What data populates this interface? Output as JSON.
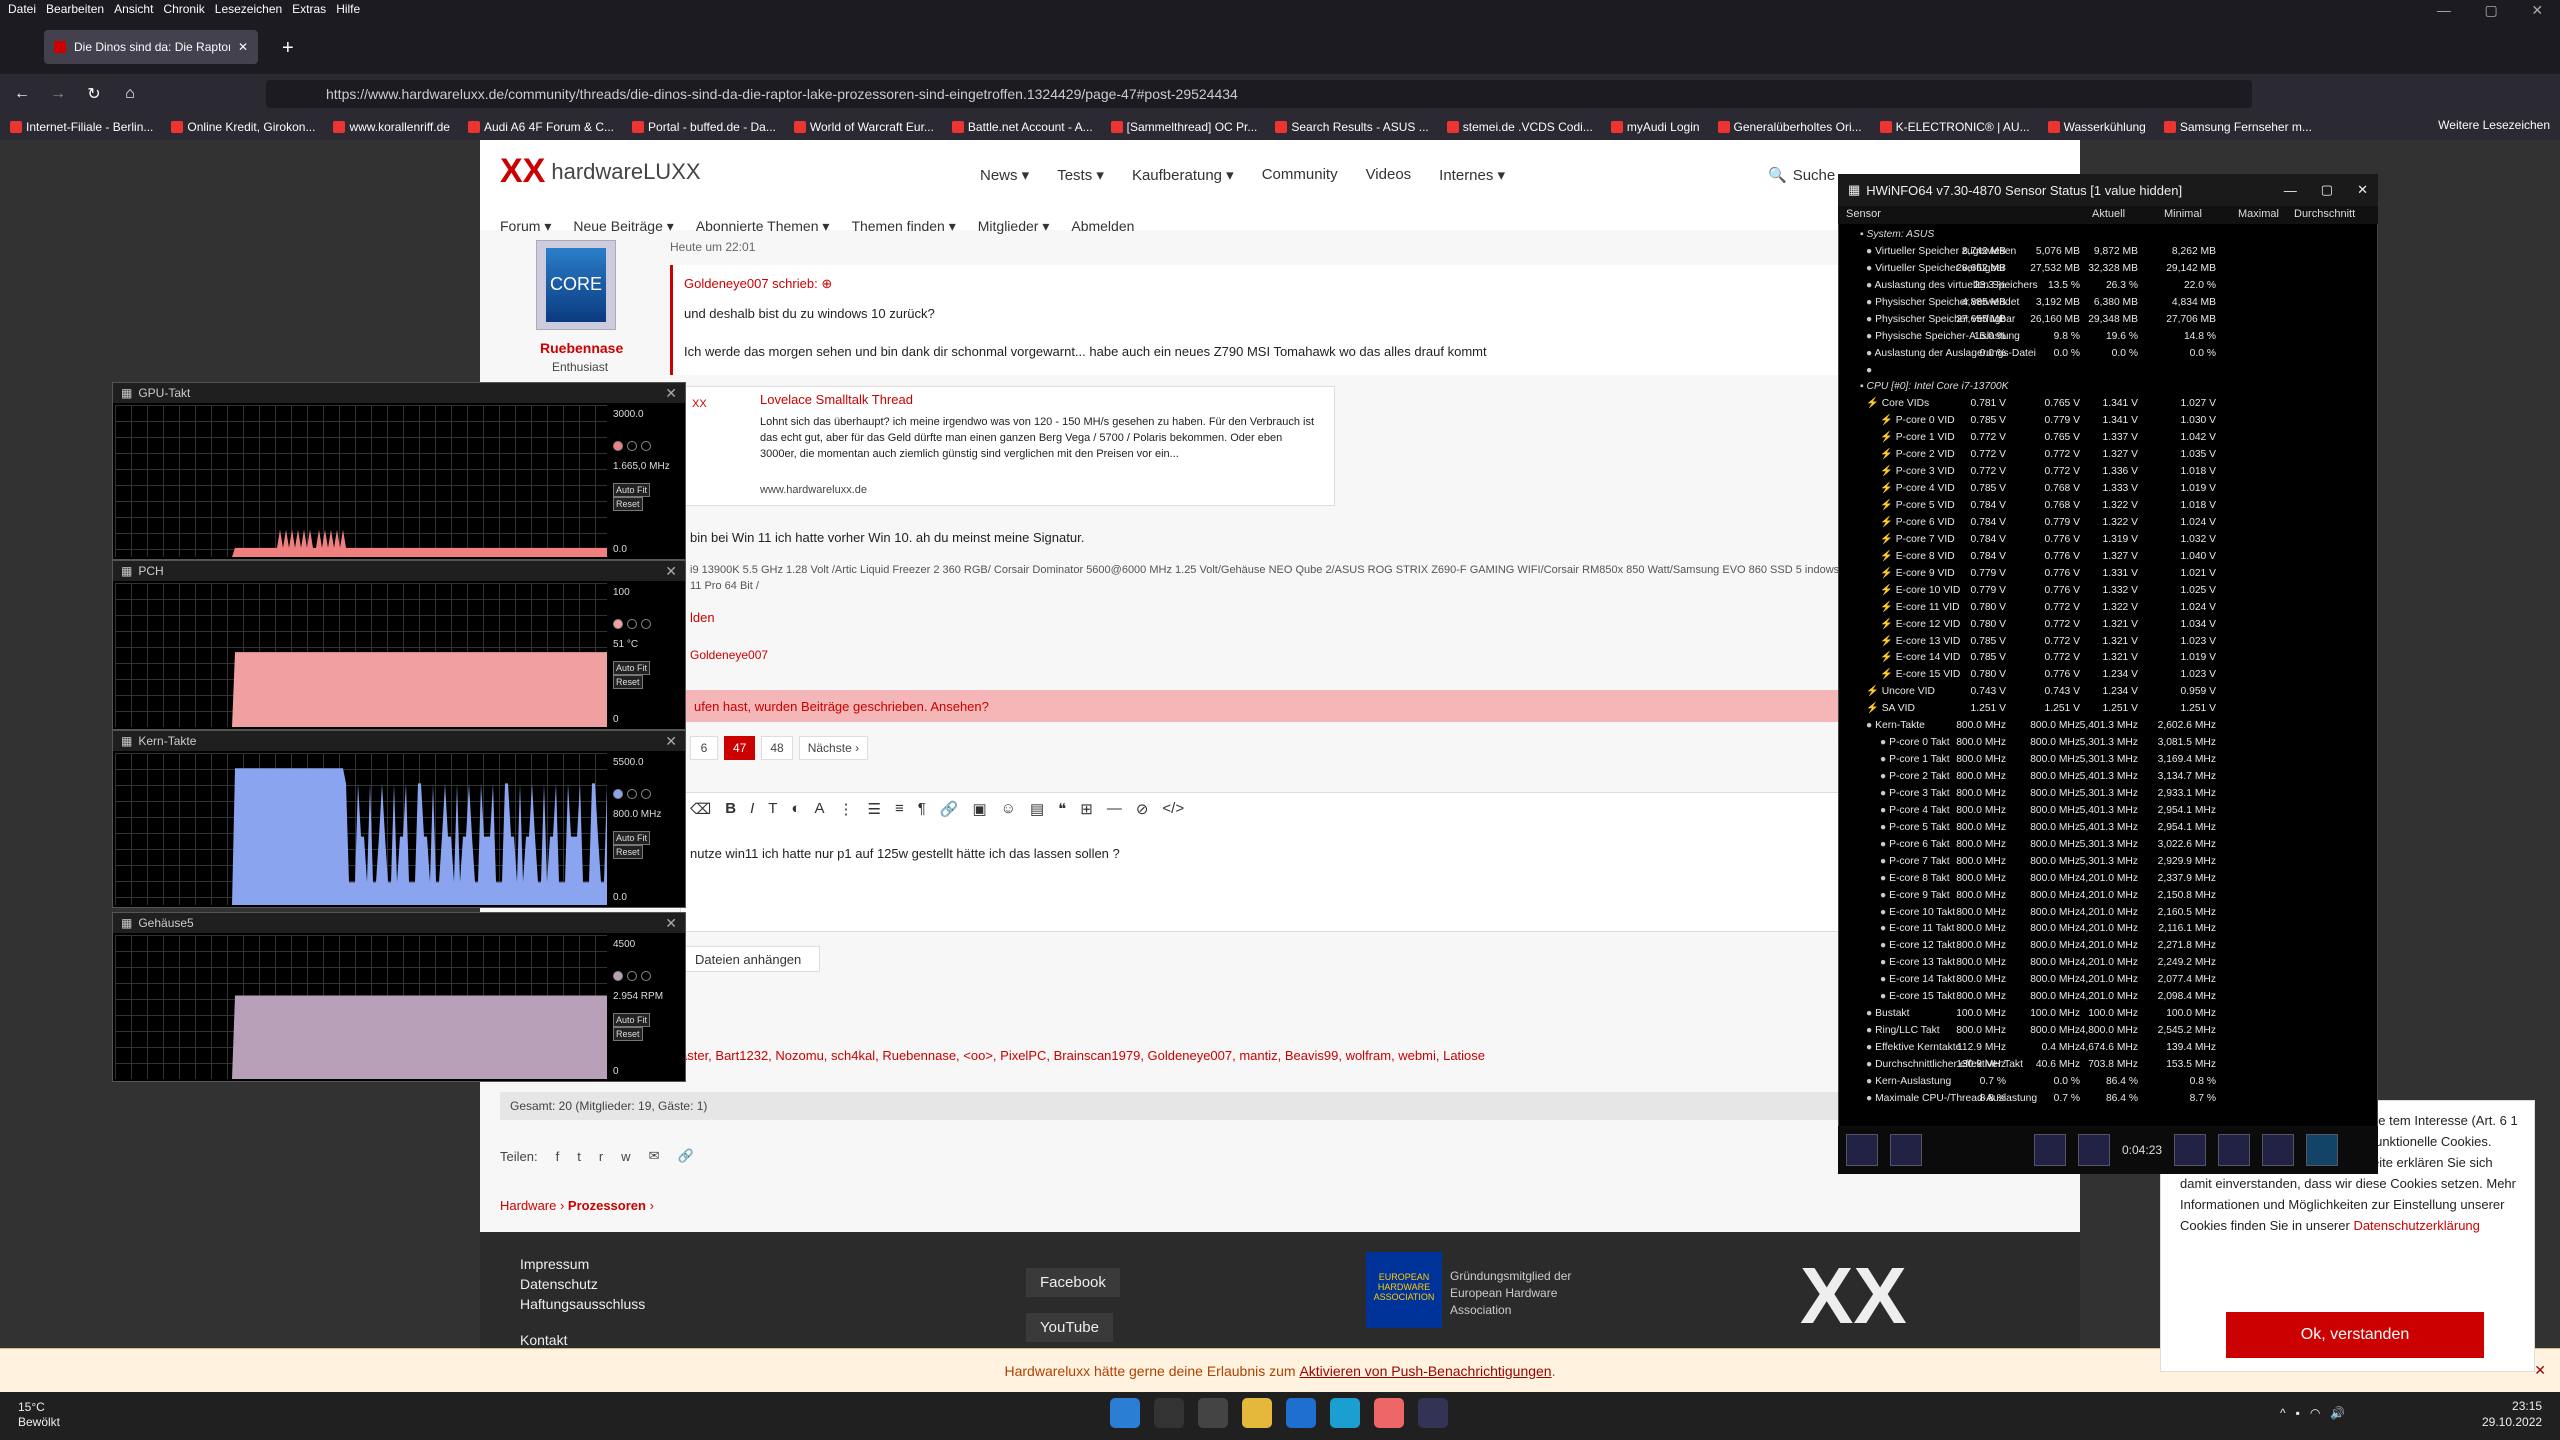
{
  "menubar": {
    "items": [
      "Datei",
      "Bearbeiten",
      "Ansicht",
      "Chronik",
      "Lesezeichen",
      "Extras",
      "Hilfe"
    ]
  },
  "tab": {
    "title": "Die Dinos sind da: Die Raptor-L"
  },
  "url": "https://www.hardwareluxx.de/community/threads/die-dinos-sind-da-die-raptor-lake-prozessoren-sind-eingetroffen.1324429/page-47#post-29524434",
  "bookmarks": [
    "Internet-Filiale - Berlin...",
    "Online Kredit, Girokon...",
    "www.korallenriff.de",
    "Audi A6 4F Forum & C...",
    "Portal - buffed.de - Da...",
    "World of Warcraft Eur...",
    "Battle.net Account - A...",
    "[Sammelthread] OC Pr...",
    "Search Results - ASUS ...",
    "stemei.de .VCDS Codi...",
    "myAudi Login",
    "Generalüberholtes Ori...",
    "K-ELECTRONIC® | AU...",
    "Wasserkühlung",
    "Samsung Fernseher m..."
  ],
  "bookmarks_other": "Weitere Lesezeichen",
  "site": {
    "logo_xx": "XX",
    "logo_text": "hardwareLUXX",
    "nav": [
      "News ▾",
      "Tests ▾",
      "Kaufberatung ▾",
      "Community",
      "Videos",
      "Internes ▾"
    ],
    "search": "Suche",
    "subnav": [
      "Forum ▾",
      "Neue Beiträge ▾",
      "Abonnierte Themen ▾",
      "Themen finden ▾",
      "Mitglieder ▾",
      "Abmelden"
    ]
  },
  "post": {
    "user": "Ruebennase",
    "role": "Enthusiast",
    "avatar_text": "CORE",
    "time": "Heute um 22:01",
    "quote_header": "Goldeneye007 schrieb: ⊕",
    "quote_l1": "und deshalb bist du zu windows 10 zurück?",
    "quote_l2": "Ich werde das morgen sehen und bin dank dir schonmal vorgewarnt... habe auch ein neues Z790 MSI Tomahawk wo das alles drauf kommt",
    "embed_title": "Lovelace Smalltalk Thread",
    "embed_text": "Lohnt sich das überhaupt? ich meine irgendwo was von 120 - 150 MH/s gesehen zu haben. Für den Verbrauch ist das echt gut, aber für das Geld dürfte man einen ganzen Berg Vega / 5700 / Polaris bekommen. Oder eben 3000er, die momentan auch ziemlich günstig sind verglichen mit den Preisen vor ein...",
    "embed_url": "www.hardwareluxx.de",
    "line": "bin bei Win 11 ich hatte vorher Win 10. ah du meinst meine Signatur.",
    "sig": "i9 13900K 5.5 GHz 1.28 Volt /Artic Liquid Freezer 2 360 RGB/ Corsair Dominator 5600@6000 MHz 1.25 Volt/Gehäuse NEO Qube 2/ASUS ROG STRIX Z690-F GAMING WIFI/Corsair RM850x 850 Watt/Samsung EVO 860 SSD 5 indows 11 Pro 64 Bit /",
    "melden": "lden",
    "likes": "Goldeneye007"
  },
  "newposts": "ufen hast, wurden Beiträge geschrieben. Ansehen?",
  "pager": [
    "6",
    "47",
    "48",
    "Nächste ›"
  ],
  "editor_text": "nutze win11 ich hatte nur p1 auf 125w gestellt hätte ich das lassen sollen ?",
  "attach": "Dateien anhängen",
  "readers": "aster, Bart1232, Nozomu, sch4kal, Ruebennase, <oo>, PixelPC, Brainscan1979, Goldeneye007, mantiz, Beavis99, wolfram, webmi, Latiose",
  "total": "Gesamt: 20 (Mitglieder: 19, Gäste: 1)",
  "share_label": "Teilen:",
  "crumb": {
    "a": "Hardware",
    "b": "Prozessoren"
  },
  "footer": {
    "links": [
      "Impressum",
      "Datenschutz",
      "Haftungsausschluss",
      "Kontakt"
    ],
    "facebook": "Facebook",
    "youtube": "YouTube",
    "euha_logo": "EUROPEAN HARDWARE ASSOCIATION",
    "euha": "Gründungsmitglied der European Hardware Association",
    "xx": "XX"
  },
  "notify": {
    "text": "Hardwareluxx hätte gerne deine Erlaubnis zum ",
    "link": "Aktivieren von Push-Benachrichtigungen",
    "end": "."
  },
  "cookie": {
    "text": "n Werbe- und r Webseite finden Sie tem Interesse (Art. 6 1 Satz 1 lit. f DSGVO) oder eigene funktionelle Cookies. Durch die Nutzung unserer Webseite erklären Sie sich damit einverstanden, dass wir diese Cookies setzen. Mehr Informationen und Möglichkeiten zur Einstellung unserer Cookies finden Sie in unserer ",
    "link": "Datenschutzerklärung",
    "button": "Ok, verstanden"
  },
  "taskbar": {
    "temp": "15°C",
    "weather": "Bewölkt",
    "time": "23:15",
    "date": "29.10.2022"
  },
  "graphs": [
    {
      "title": "GPU-Takt",
      "max": "3000.0",
      "value": "1.665,0 MHz",
      "min": "0.0",
      "color": "#f08080"
    },
    {
      "title": "PCH",
      "max": "100",
      "value": "51 °C",
      "min": "0",
      "color": "#f0a0a0"
    },
    {
      "title": "Kern-Takte",
      "max": "5500.0",
      "value": "800.0 MHz",
      "min": "0.0",
      "color": "#8aa4f0"
    },
    {
      "title": "Gehäuse5",
      "max": "4500",
      "value": "2.954 RPM",
      "min": "0",
      "color": "#b8a0b8"
    }
  ],
  "graph_buttons": [
    "Auto Fit",
    "Reset"
  ],
  "hwinfo": {
    "title": "HWiNFO64 v7.30-4870 Sensor Status [1 value hidden]",
    "cols": [
      "Sensor",
      "Aktuell",
      "Minimal",
      "Maximal",
      "Durchschnitt"
    ],
    "uptime": "0:04:23",
    "rows": [
      [
        "System: ASUS",
        "",
        "",
        "",
        ""
      ],
      [
        "Virtueller Speicher zugewiesen",
        "8,742 MB",
        "5,076 MB",
        "9,872 MB",
        "8,262 MB"
      ],
      [
        "Virtueller Speicher verfügbar",
        "28,662 MB",
        "27,532 MB",
        "32,328 MB",
        "29,142 MB"
      ],
      [
        "Auslastung des virtuellen Speichers",
        "23.3 %",
        "13.5 %",
        "26.3 %",
        "22.0 %"
      ],
      [
        "Physischer Speicher verwendet",
        "4,885 MB",
        "3,192 MB",
        "6,380 MB",
        "4,834 MB"
      ],
      [
        "Physischer Speicher verfügbar",
        "27,655 MB",
        "26,160 MB",
        "29,348 MB",
        "27,706 MB"
      ],
      [
        "Physische Speicher-Auslastung",
        "15.0 %",
        "9.8 %",
        "19.6 %",
        "14.8 %"
      ],
      [
        "Auslastung der Auslagerungs-Datei",
        "0.0 %",
        "0.0 %",
        "0.0 %",
        "0.0 %"
      ],
      [
        "",
        "",
        "",
        "",
        ""
      ],
      [
        "CPU [#0]: Intel Core i7-13700K",
        "",
        "",
        "",
        ""
      ],
      [
        "Core VIDs",
        "0.781 V",
        "0.765 V",
        "1.341 V",
        "1.027 V"
      ],
      [
        "P-core 0 VID",
        "0.785 V",
        "0.779 V",
        "1.341 V",
        "1.030 V"
      ],
      [
        "P-core 1 VID",
        "0.772 V",
        "0.765 V",
        "1.337 V",
        "1.042 V"
      ],
      [
        "P-core 2 VID",
        "0.772 V",
        "0.772 V",
        "1.327 V",
        "1.035 V"
      ],
      [
        "P-core 3 VID",
        "0.772 V",
        "0.772 V",
        "1.336 V",
        "1.018 V"
      ],
      [
        "P-core 4 VID",
        "0.785 V",
        "0.768 V",
        "1.333 V",
        "1.019 V"
      ],
      [
        "P-core 5 VID",
        "0.784 V",
        "0.768 V",
        "1.322 V",
        "1.018 V"
      ],
      [
        "P-core 6 VID",
        "0.784 V",
        "0.779 V",
        "1.322 V",
        "1.024 V"
      ],
      [
        "P-core 7 VID",
        "0.784 V",
        "0.776 V",
        "1.319 V",
        "1.032 V"
      ],
      [
        "E-core 8 VID",
        "0.784 V",
        "0.776 V",
        "1.327 V",
        "1.040 V"
      ],
      [
        "E-core 9 VID",
        "0.779 V",
        "0.776 V",
        "1.331 V",
        "1.021 V"
      ],
      [
        "E-core 10 VID",
        "0.779 V",
        "0.776 V",
        "1.332 V",
        "1.025 V"
      ],
      [
        "E-core 11 VID",
        "0.780 V",
        "0.772 V",
        "1.322 V",
        "1.024 V"
      ],
      [
        "E-core 12 VID",
        "0.780 V",
        "0.772 V",
        "1.321 V",
        "1.034 V"
      ],
      [
        "E-core 13 VID",
        "0.785 V",
        "0.772 V",
        "1.321 V",
        "1.023 V"
      ],
      [
        "E-core 14 VID",
        "0.785 V",
        "0.772 V",
        "1.321 V",
        "1.019 V"
      ],
      [
        "E-core 15 VID",
        "0.780 V",
        "0.776 V",
        "1.234 V",
        "1.023 V"
      ],
      [
        "Uncore VID",
        "0.743 V",
        "0.743 V",
        "1.234 V",
        "0.959 V"
      ],
      [
        "SA VID",
        "1.251 V",
        "1.251 V",
        "1.251 V",
        "1.251 V"
      ],
      [
        "Kern-Takte",
        "800.0 MHz",
        "800.0 MHz",
        "5,401.3 MHz",
        "2,602.6 MHz"
      ],
      [
        "P-core 0 Takt",
        "800.0 MHz",
        "800.0 MHz",
        "5,301.3 MHz",
        "3,081.5 MHz"
      ],
      [
        "P-core 1 Takt",
        "800.0 MHz",
        "800.0 MHz",
        "5,301.3 MHz",
        "3,169.4 MHz"
      ],
      [
        "P-core 2 Takt",
        "800.0 MHz",
        "800.0 MHz",
        "5,401.3 MHz",
        "3,134.7 MHz"
      ],
      [
        "P-core 3 Takt",
        "800.0 MHz",
        "800.0 MHz",
        "5,301.3 MHz",
        "2,933.1 MHz"
      ],
      [
        "P-core 4 Takt",
        "800.0 MHz",
        "800.0 MHz",
        "5,401.3 MHz",
        "2,954.1 MHz"
      ],
      [
        "P-core 5 Takt",
        "800.0 MHz",
        "800.0 MHz",
        "5,401.3 MHz",
        "2,954.1 MHz"
      ],
      [
        "P-core 6 Takt",
        "800.0 MHz",
        "800.0 MHz",
        "5,301.3 MHz",
        "3,022.6 MHz"
      ],
      [
        "P-core 7 Takt",
        "800.0 MHz",
        "800.0 MHz",
        "5,301.3 MHz",
        "2,929.9 MHz"
      ],
      [
        "E-core 8 Takt",
        "800.0 MHz",
        "800.0 MHz",
        "4,201.0 MHz",
        "2,337.9 MHz"
      ],
      [
        "E-core 9 Takt",
        "800.0 MHz",
        "800.0 MHz",
        "4,201.0 MHz",
        "2,150.8 MHz"
      ],
      [
        "E-core 10 Takt",
        "800.0 MHz",
        "800.0 MHz",
        "4,201.0 MHz",
        "2,160.5 MHz"
      ],
      [
        "E-core 11 Takt",
        "800.0 MHz",
        "800.0 MHz",
        "4,201.0 MHz",
        "2,116.1 MHz"
      ],
      [
        "E-core 12 Takt",
        "800.0 MHz",
        "800.0 MHz",
        "4,201.0 MHz",
        "2,271.8 MHz"
      ],
      [
        "E-core 13 Takt",
        "800.0 MHz",
        "800.0 MHz",
        "4,201.0 MHz",
        "2,249.2 MHz"
      ],
      [
        "E-core 14 Takt",
        "800.0 MHz",
        "800.0 MHz",
        "4,201.0 MHz",
        "2,077.4 MHz"
      ],
      [
        "E-core 15 Takt",
        "800.0 MHz",
        "800.0 MHz",
        "4,201.0 MHz",
        "2,098.4 MHz"
      ],
      [
        "Bustakt",
        "100.0 MHz",
        "100.0 MHz",
        "100.0 MHz",
        "100.0 MHz"
      ],
      [
        "Ring/LLC Takt",
        "800.0 MHz",
        "800.0 MHz",
        "4,800.0 MHz",
        "2,545.2 MHz"
      ],
      [
        "Effektive Kerntakte",
        "112.9 MHz",
        "0.4 MHz",
        "4,674.6 MHz",
        "139.4 MHz"
      ],
      [
        "Durchschnittlicher effektiver Takt",
        "130.9 MHz",
        "40.6 MHz",
        "703.8 MHz",
        "153.5 MHz"
      ],
      [
        "Kern-Auslastung",
        "0.7 %",
        "0.0 %",
        "86.4 %",
        "0.8 %"
      ],
      [
        "Maximale CPU-/Thread-Auslastung",
        "8.8 %",
        "0.7 %",
        "86.4 %",
        "8.7 %"
      ]
    ]
  }
}
